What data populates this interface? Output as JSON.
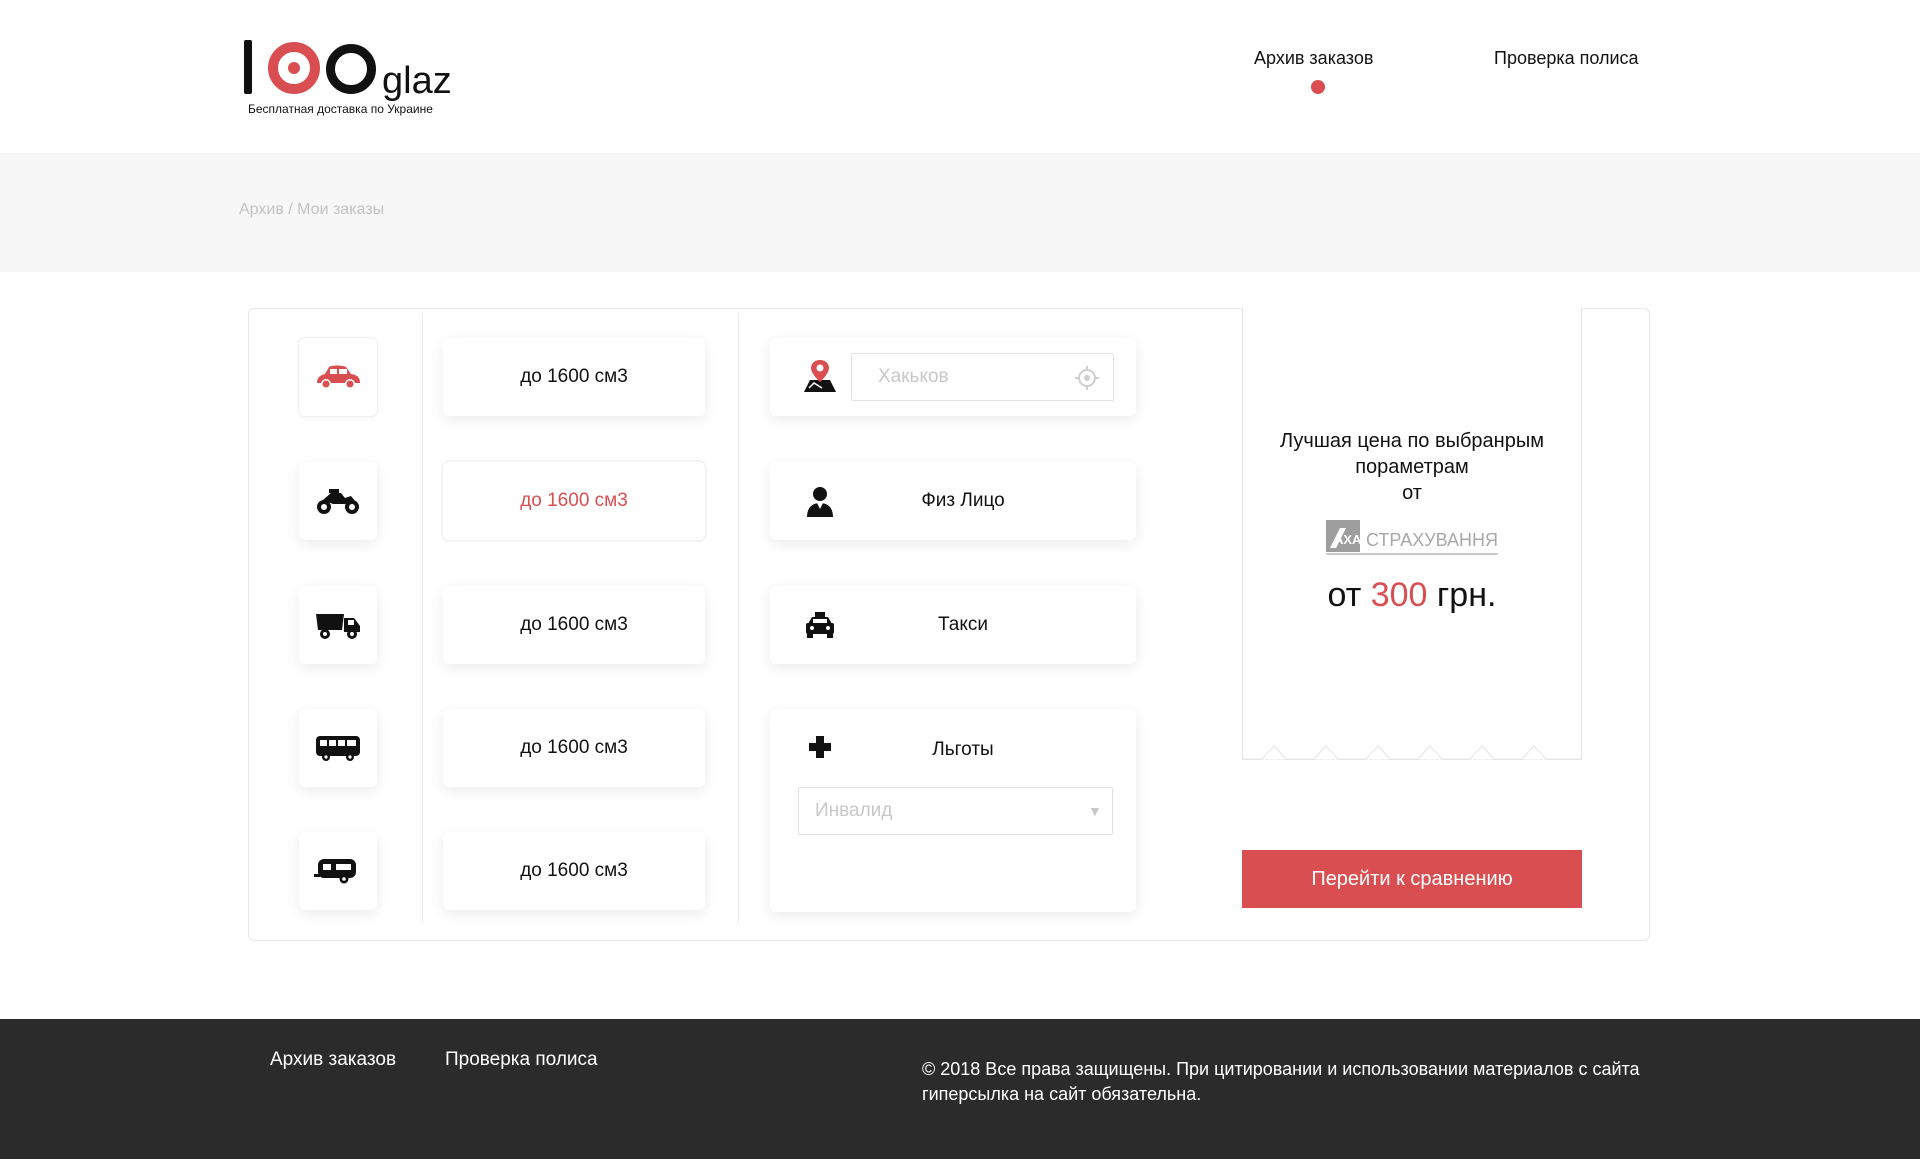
{
  "header": {
    "logo_text": "glaz",
    "tagline": "Бесплатная доставка по Украине",
    "nav": [
      {
        "label": "Архив заказов",
        "active": true
      },
      {
        "label": "Проверка полиса",
        "active": false
      }
    ]
  },
  "breadcrumb": "Архив / Мои заказы",
  "vehicles": [
    {
      "icon": "car-icon",
      "active": true
    },
    {
      "icon": "motorcycle-icon",
      "active": false
    },
    {
      "icon": "truck-icon",
      "active": false
    },
    {
      "icon": "bus-icon",
      "active": false
    },
    {
      "icon": "trailer-icon",
      "active": false
    }
  ],
  "capacities": [
    {
      "label": "до 1600 см3",
      "active": false
    },
    {
      "label": "до 1600 см3",
      "active": true
    },
    {
      "label": "до 1600 см3",
      "active": false
    },
    {
      "label": "до 1600 см3",
      "active": false
    },
    {
      "label": "до 1600 см3",
      "active": false
    }
  ],
  "options": {
    "city_placeholder": "Хакьков",
    "person_label": "Физ Лицо",
    "taxi_label": "Такси",
    "benefits_label": "Льготы",
    "benefits_value": "Инвалид"
  },
  "receipt": {
    "line1": "Лучшая цена по выбранрым",
    "line2": "пораметрам",
    "line3": "от",
    "insurer_logo": "AXA СТРАХУВАННЯ",
    "insurer_name": "СТРАХУВАННЯ",
    "price_prefix": "от",
    "price_amount": "300",
    "price_suffix": "грн."
  },
  "compare_button": "Перейти к сравнению",
  "footer": {
    "links": [
      "Архив заказов",
      "Проверка полиса"
    ],
    "copyright": "©  2018 Все права защищены. При цитировании и использовании материалов с сайта гиперсылка на сайт обязательна."
  },
  "colors": {
    "accent": "#d94f51",
    "footer_bg": "#2b2b2b",
    "band_bg": "#f7f7f7"
  }
}
